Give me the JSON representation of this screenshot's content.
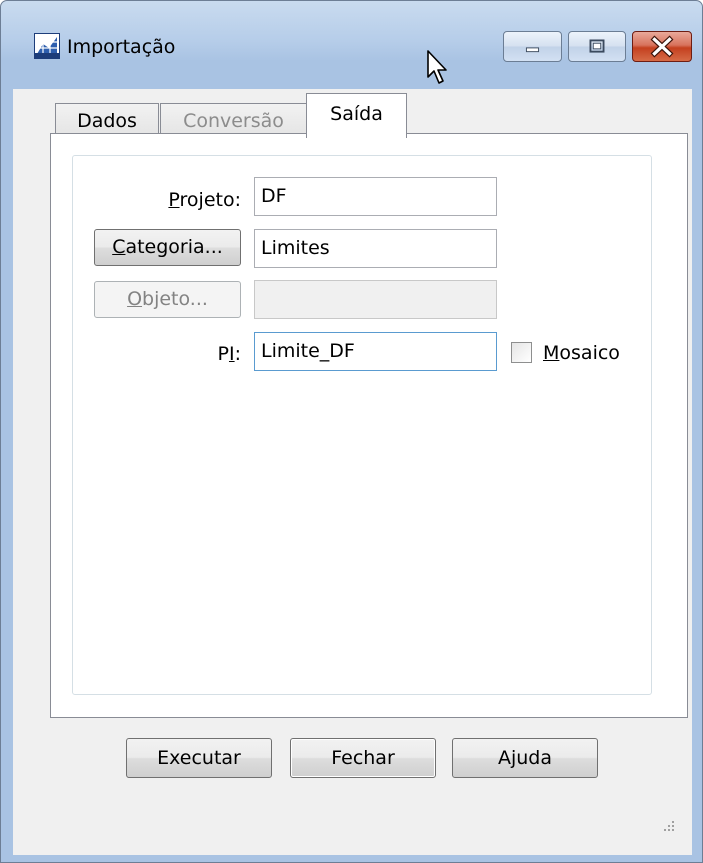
{
  "window": {
    "title": "Importação",
    "icons": {
      "app": "map-grid-icon",
      "minimize": "minimize-icon",
      "maximize": "maximize-icon",
      "close": "close-icon",
      "cursor": "mouse-pointer-icon",
      "grip": "resize-grip-icon"
    }
  },
  "tabs": [
    {
      "label": "Dados",
      "state": "normal"
    },
    {
      "label": "Conversão",
      "state": "disabled"
    },
    {
      "label": "Saída",
      "state": "selected"
    }
  ],
  "form": {
    "projeto": {
      "label_mnemonic": "P",
      "label_rest": "rojeto:",
      "value": "DF"
    },
    "categoria": {
      "button_mnemonic": "C",
      "button_rest": "ategoria...",
      "value": "Limites"
    },
    "objeto": {
      "button_mnemonic": "O",
      "button_rest": "bjeto...",
      "value": "",
      "disabled": true
    },
    "pi": {
      "label_start": "P",
      "label_mnemonic": "I",
      "label_end": ":",
      "value": "Limite_DF"
    },
    "mosaico": {
      "label_mnemonic": "M",
      "label_rest": "osaico",
      "checked": false
    }
  },
  "buttons": {
    "executar": "Executar",
    "fechar": "Fechar",
    "ajuda": "Ajuda"
  },
  "colors": {
    "frame": "#a9c3e3",
    "close_button": "#c4401f",
    "dialog_face": "#f0f0f0"
  }
}
